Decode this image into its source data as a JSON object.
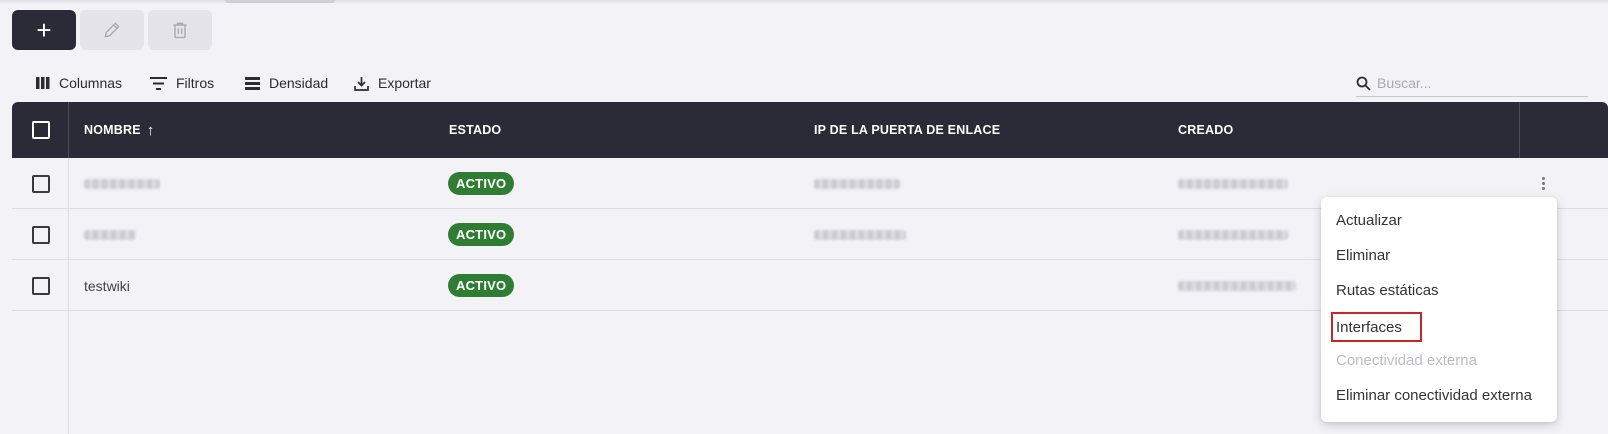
{
  "actions": {
    "add_label": "+"
  },
  "toolbar": {
    "columns_label": "Columnas",
    "filters_label": "Filtros",
    "density_label": "Densidad",
    "export_label": "Exportar"
  },
  "search": {
    "placeholder": "Buscar..."
  },
  "table": {
    "columns": [
      "NOMBRE",
      "ESTADO",
      "IP DE LA PUERTA DE ENLACE",
      "CREADO"
    ],
    "sort_indicator": "↑",
    "rows": [
      {
        "name": "",
        "status": "ACTIVO",
        "gateway_ip": "",
        "created": ""
      },
      {
        "name": "",
        "status": "ACTIVO",
        "gateway_ip": "",
        "created": ""
      },
      {
        "name": "testwiki",
        "status": "ACTIVO",
        "gateway_ip": "",
        "created": ""
      }
    ]
  },
  "context_menu": {
    "items": [
      {
        "label": "Actualizar",
        "disabled": false
      },
      {
        "label": "Eliminar",
        "disabled": false
      },
      {
        "label": "Rutas estáticas",
        "disabled": false
      },
      {
        "label": "Interfaces",
        "disabled": false,
        "highlighted": true
      },
      {
        "label": "Conectividad externa",
        "disabled": true
      },
      {
        "label": "Eliminar conectividad externa",
        "disabled": false
      }
    ]
  },
  "colors": {
    "header_bg": "#2b2b38",
    "status_active": "#2e7d32",
    "highlight_outline": "#c62828"
  }
}
